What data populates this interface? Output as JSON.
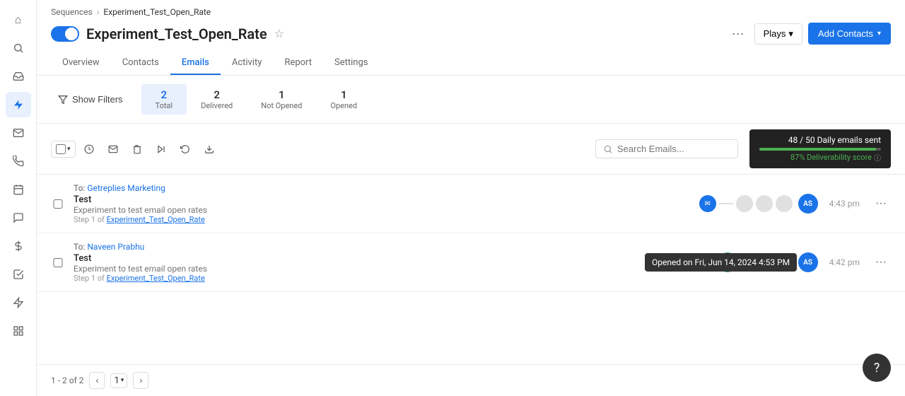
{
  "breadcrumb": {
    "parent": "Sequences",
    "separator": "›",
    "current": "Experiment_Test_Open_Rate"
  },
  "header": {
    "title": "Experiment_Test_Open_Rate",
    "more_label": "···",
    "plays_label": "Plays",
    "add_contacts_label": "Add Contacts"
  },
  "nav_tabs": [
    {
      "label": "Overview",
      "active": false
    },
    {
      "label": "Contacts",
      "active": false
    },
    {
      "label": "Emails",
      "active": true
    },
    {
      "label": "Activity",
      "active": false
    },
    {
      "label": "Report",
      "active": false
    },
    {
      "label": "Settings",
      "active": false
    }
  ],
  "filters": {
    "show_filters_label": "Show Filters",
    "stats": [
      {
        "num": "2",
        "label": "Total",
        "active": true
      },
      {
        "num": "2",
        "label": "Delivered",
        "active": false
      },
      {
        "num": "1",
        "label": "Not Opened",
        "active": false
      },
      {
        "num": "1",
        "label": "Opened",
        "active": false
      }
    ]
  },
  "toolbar": {
    "search_placeholder": "Search Emails..."
  },
  "daily_quota": {
    "label": "48 / 50 Daily emails sent",
    "deliverability": "87% Deliverability score"
  },
  "emails": [
    {
      "to_label": "To:",
      "to_name": "Getreplies Marketing",
      "subject": "Test",
      "body": "Experiment to test email open rates",
      "step": "Step 1 of",
      "step_link": "Experiment_Test_Open_Rate",
      "time": "4:43 pm",
      "avatar": "AS",
      "opened": false
    },
    {
      "to_label": "To:",
      "to_name": "Naveen Prabhu",
      "subject": "Test",
      "body": "Experiment to test email open rates",
      "step": "Step 1 of",
      "step_link": "Experiment_Test_Open_Rate",
      "time": "4:42 pm",
      "avatar": "AS",
      "opened": true,
      "tooltip": "Opened on Fri, Jun 14, 2024 4:53 PM"
    }
  ],
  "pagination": {
    "info": "1 - 2 of 2",
    "page": "1"
  },
  "help": {
    "icon": "?"
  },
  "sidebar_icons": [
    {
      "name": "home",
      "symbol": "⌂",
      "active": false
    },
    {
      "name": "search",
      "symbol": "🔍",
      "active": false
    },
    {
      "name": "inbox",
      "symbol": "✉",
      "active": false
    },
    {
      "name": "sequences",
      "symbol": "⚡",
      "active": true
    },
    {
      "name": "mail",
      "symbol": "📧",
      "active": false
    },
    {
      "name": "phone",
      "symbol": "📞",
      "active": false
    },
    {
      "name": "calendar",
      "symbol": "📅",
      "active": false
    },
    {
      "name": "chat",
      "symbol": "💬",
      "active": false
    },
    {
      "name": "dollar",
      "symbol": "$",
      "active": false
    },
    {
      "name": "tasks",
      "symbol": "✓",
      "active": false
    },
    {
      "name": "bolt",
      "symbol": "⚡",
      "active": false
    },
    {
      "name": "grid",
      "symbol": "⊞",
      "active": false
    },
    {
      "name": "settings",
      "symbol": "⚙",
      "active": false
    }
  ]
}
